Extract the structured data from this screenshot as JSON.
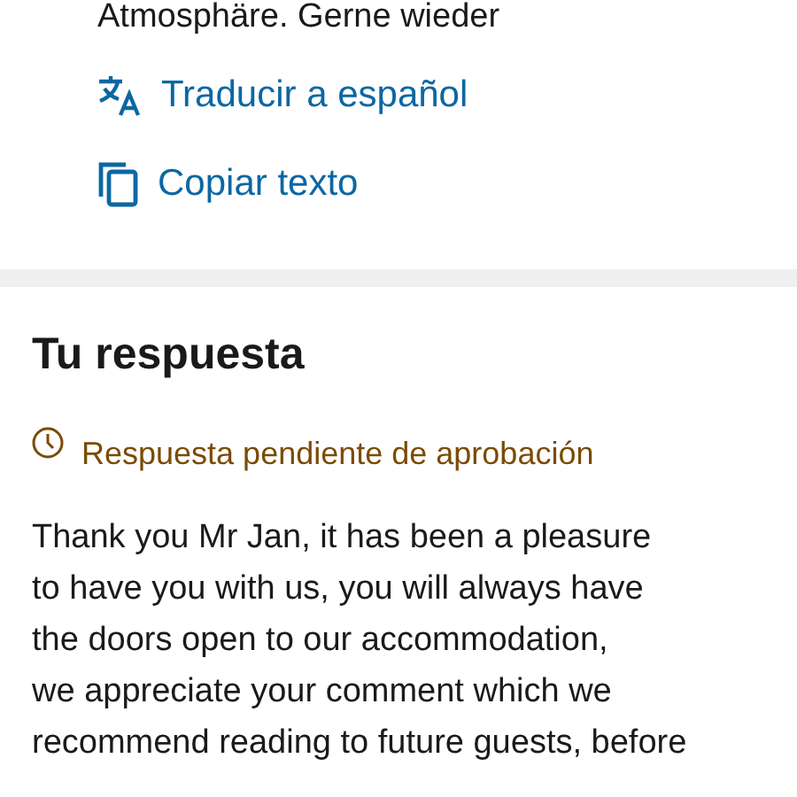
{
  "review": {
    "text_tail": "Atmosphäre. Gerne wieder",
    "actions": [
      {
        "kind": "translate",
        "label": "Traducir a español"
      },
      {
        "kind": "copy",
        "label": "Copiar texto"
      }
    ]
  },
  "reply": {
    "title": "Tu respuesta",
    "status": {
      "kind": "pending",
      "label": "Respuesta pendiente de aprobación"
    },
    "lines": [
      "Thank you Mr Jan, it has been a pleasure",
      "to have you with us, you will always have",
      "the doors open to our accommodation,",
      "we appreciate your comment which we",
      "recommend reading to future guests, before"
    ]
  }
}
